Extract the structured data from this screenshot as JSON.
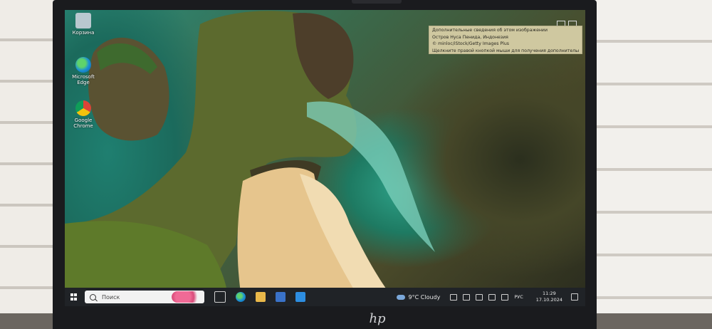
{
  "desktop": {
    "icons": [
      {
        "label": "Корзина"
      },
      {
        "label": "Microsoft Edge"
      },
      {
        "label": "Google Chrome"
      }
    ]
  },
  "info_box": {
    "line1": "Дополнительные сведения об этом изображении",
    "line2": "Остров Нуса Пенида, Индонезия",
    "line3": "© minloc/iStock/Getty Images Plus",
    "line4": "Щелкните правой кнопкой мыши для получения дополнительных св"
  },
  "taskbar": {
    "search_placeholder": "Поиск",
    "weather": "9°C Cloudy",
    "lang": "РУС",
    "time": "11:29",
    "date": "17.10.2024"
  },
  "brand": {
    "logo": "hp"
  },
  "colors": {
    "taskbar": "#202327",
    "bezel": "#1a1b1e",
    "info_box": "#cfc8a0"
  }
}
